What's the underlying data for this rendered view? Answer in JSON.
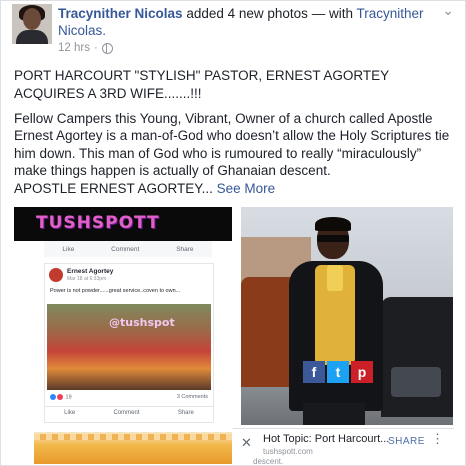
{
  "post": {
    "author": "Tracynither Nicolas",
    "action": "added 4 new photos",
    "with_text": "— with",
    "tagged": "Tracynither Nicolas.",
    "time": "12 hrs",
    "separator": "·",
    "headline": "PORT HARCOURT \"STYLISH\" PASTOR, ERNEST AGORTEY ACQUIRES A 3RD WIFE.......!!!",
    "body": "Fellow Campers this Young, Vibrant, Owner of a church called Apostle Ernest Agortey is a man-of-God who doesn’t allow the Holy Scriptures tie him down. This man of God who is rumoured to really “miraculously” make things happen is actually of Ghanaian descent.",
    "tail": "APOSTLE ERNEST AGORTEY...",
    "see_more": "See More"
  },
  "photo1": {
    "watermark": "TUSHSPOTT",
    "bar": {
      "like": "Like",
      "comment": "Comment",
      "share": "Share"
    },
    "card": {
      "name": "Ernest Agortey",
      "sub": "Mar 18 at 6:33pm ·",
      "text": "Power is not powder......great service..coven to own...",
      "image_watermark": "@tushspot",
      "likes": "19",
      "comments": "3 Comments",
      "actions": {
        "like": "Like",
        "comment": "Comment",
        "share": "Share"
      }
    }
  },
  "photo2": {
    "share_icons": {
      "facebook": "f",
      "twitter": "t",
      "pinterest": "p"
    }
  },
  "adbar": {
    "close": "✕",
    "title": "Hot Topic: Port Harcourt...",
    "url": "tushspott.com",
    "share": "SHARE",
    "menu": "⋮",
    "desc": "descent."
  },
  "icons": {
    "chevron": "chevron-down-icon",
    "globe": "globe-icon"
  }
}
